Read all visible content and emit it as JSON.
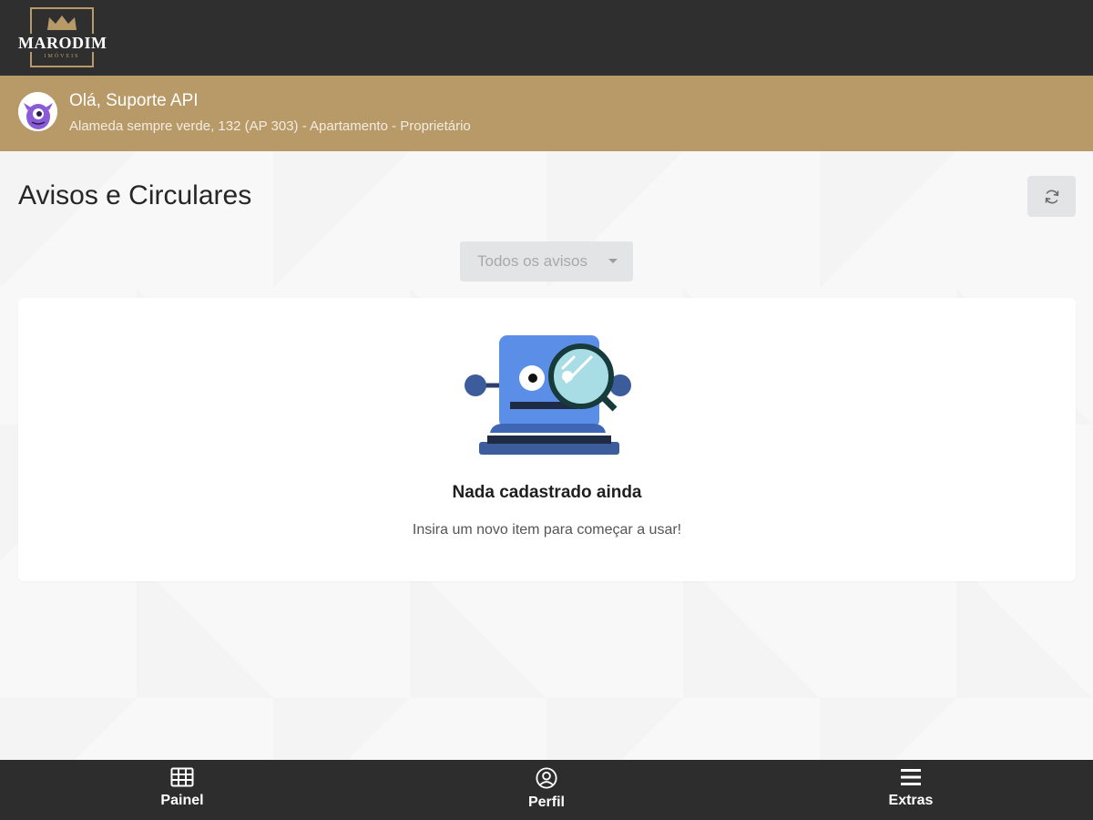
{
  "brand": {
    "name": "MARODIM",
    "tagline": "IMÓVEIS",
    "colors": {
      "header": "#2f2f2f",
      "gold": "#b89a68",
      "nav": "#2d2d2d"
    }
  },
  "user": {
    "greeting": "Olá, Suporte API",
    "address": "Alameda sempre verde, 132 (AP 303) - Apartamento - Proprietário",
    "avatar_icon": "purple-monster-avatar"
  },
  "page": {
    "title": "Avisos e Circulares",
    "refresh_icon": "refresh-icon"
  },
  "filter": {
    "selected": "Todos os avisos"
  },
  "empty_state": {
    "title": "Nada cadastrado ainda",
    "subtitle": "Insira um novo item para começar a usar!",
    "illustration": "robot-magnifier-illustration"
  },
  "bottom_nav": {
    "items": [
      {
        "label": "Painel",
        "icon": "grid-icon"
      },
      {
        "label": "Perfil",
        "icon": "user-circle-icon"
      },
      {
        "label": "Extras",
        "icon": "menu-icon"
      }
    ]
  }
}
